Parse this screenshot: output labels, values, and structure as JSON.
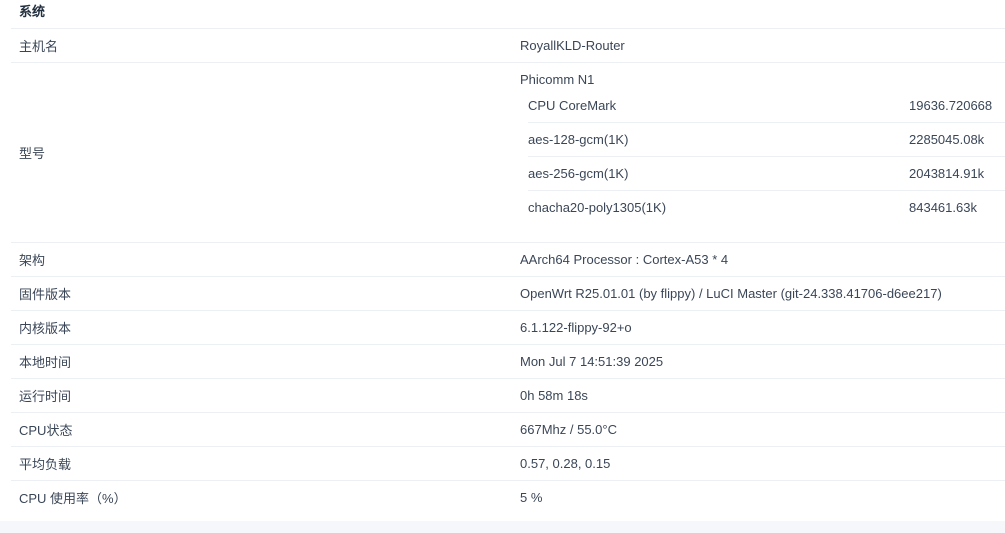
{
  "section": {
    "title": "系统"
  },
  "rows": {
    "hostname": {
      "label": "主机名",
      "value": "RoyallKLD-Router"
    },
    "model": {
      "label": "型号",
      "value": "Phicomm N1",
      "bench": [
        {
          "name": "CPU CoreMark",
          "value": "19636.720668"
        },
        {
          "name": "aes-128-gcm(1K)",
          "value": "2285045.08k"
        },
        {
          "name": "aes-256-gcm(1K)",
          "value": "2043814.91k"
        },
        {
          "name": "chacha20-poly1305(1K)",
          "value": "843461.63k"
        }
      ]
    },
    "arch": {
      "label": "架构",
      "value": "AArch64 Processor : Cortex-A53 * 4"
    },
    "firmware": {
      "label": "固件版本",
      "value": "OpenWrt R25.01.01 (by flippy) / LuCI Master (git-24.338.41706-d6ee217)"
    },
    "kernel": {
      "label": "内核版本",
      "value": "6.1.122-flippy-92+o"
    },
    "localtime": {
      "label": "本地时间",
      "value": "Mon Jul 7 14:51:39 2025"
    },
    "uptime": {
      "label": "运行时间",
      "value": "0h 58m 18s"
    },
    "cpustatus": {
      "label": "CPU状态",
      "value": "667Mhz / 55.0°C"
    },
    "load": {
      "label": "平均负载",
      "value": "0.57, 0.28, 0.15"
    },
    "cpuusage": {
      "label": "CPU 使用率（%）",
      "value": "5 %"
    }
  }
}
